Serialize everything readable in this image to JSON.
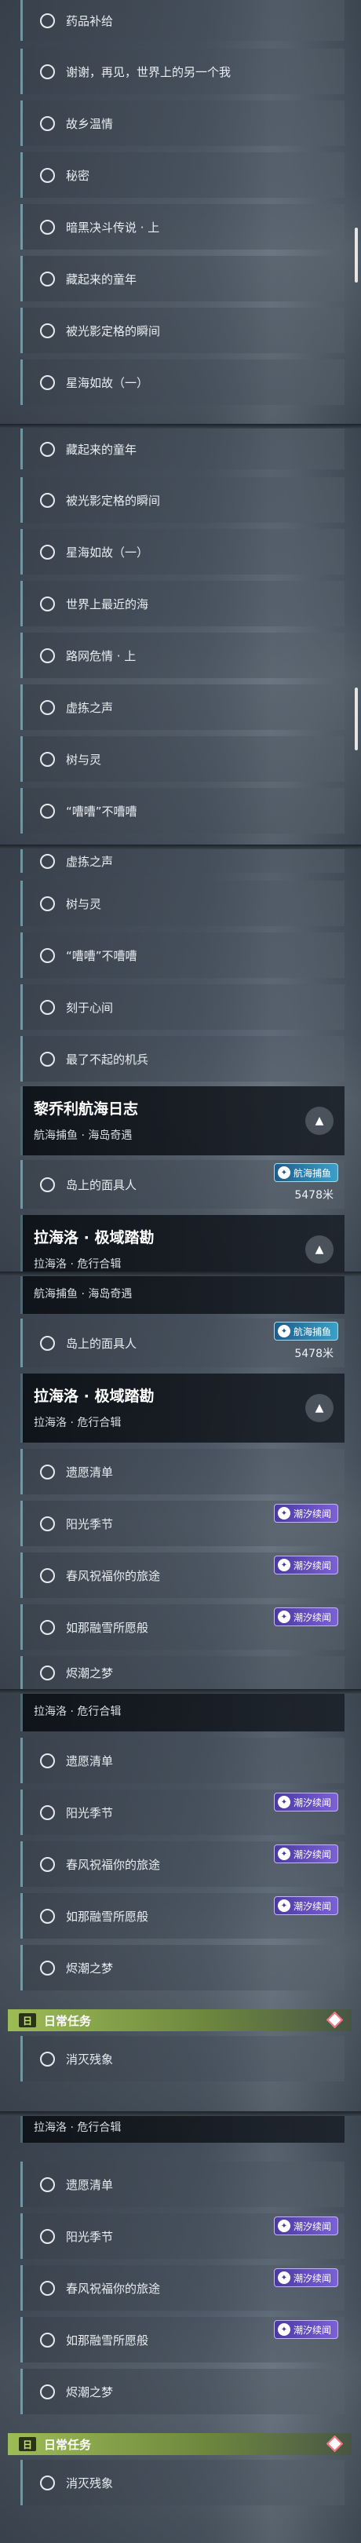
{
  "tags": {
    "hang_hai_bu_yu": "航海捕鱼",
    "chao_xi_xu_wen": "潮汐续闻"
  },
  "icons": {
    "tag_icon_glyph": "✦",
    "collapse_glyph": "▲",
    "daily_glyph": "日"
  },
  "quest_title_li": "黎乔利航海日志",
  "quest_sub_li": "航海捕鱼 · 海岛奇遇",
  "quest_title_la": "拉海洛 · 极域踏勘",
  "quest_sub_la": "拉海洛 · 危行合辑",
  "distance": "5478米",
  "daily_label": "日常任务",
  "panels": [
    {
      "rows": [
        "药品补给",
        "谢谢，再见，世界上的另一个我",
        "故乡温情",
        "秘密",
        "暗黑决斗传说 · 上",
        "藏起来的童年",
        "被光影定格的瞬间",
        "星海如故（一）"
      ]
    },
    {
      "rows": [
        "藏起来的童年",
        "被光影定格的瞬间",
        "星海如故（一）",
        "世界上最近的海",
        "路网危情 · 上",
        "虚拣之声",
        "树与灵",
        "“嘈嘈”不嘈嘈"
      ]
    },
    {
      "rows": [
        "虚拣之声",
        "树与灵",
        "“嘈嘈”不嘈嘈",
        "刻于心间",
        "最了不起的机兵"
      ],
      "row_island": "岛上的面具人"
    },
    {
      "row_island": "岛上的面具人",
      "rows": [
        "遗愿清单",
        "阳光季节",
        "春风祝福你的旅途",
        "如那融雪所愿般",
        "烬潮之梦"
      ]
    },
    {
      "rows": [
        "遗愿清单",
        "阳光季节",
        "春风祝福你的旅途",
        "如那融雪所愿般",
        "烬潮之梦"
      ],
      "row_daily": "消灭残象"
    },
    {
      "rows": [
        "遗愿清单",
        "阳光季节",
        "春风祝福你的旅途",
        "如那融雪所愿般",
        "烬潮之梦"
      ],
      "row_daily": "消灭残象"
    }
  ]
}
